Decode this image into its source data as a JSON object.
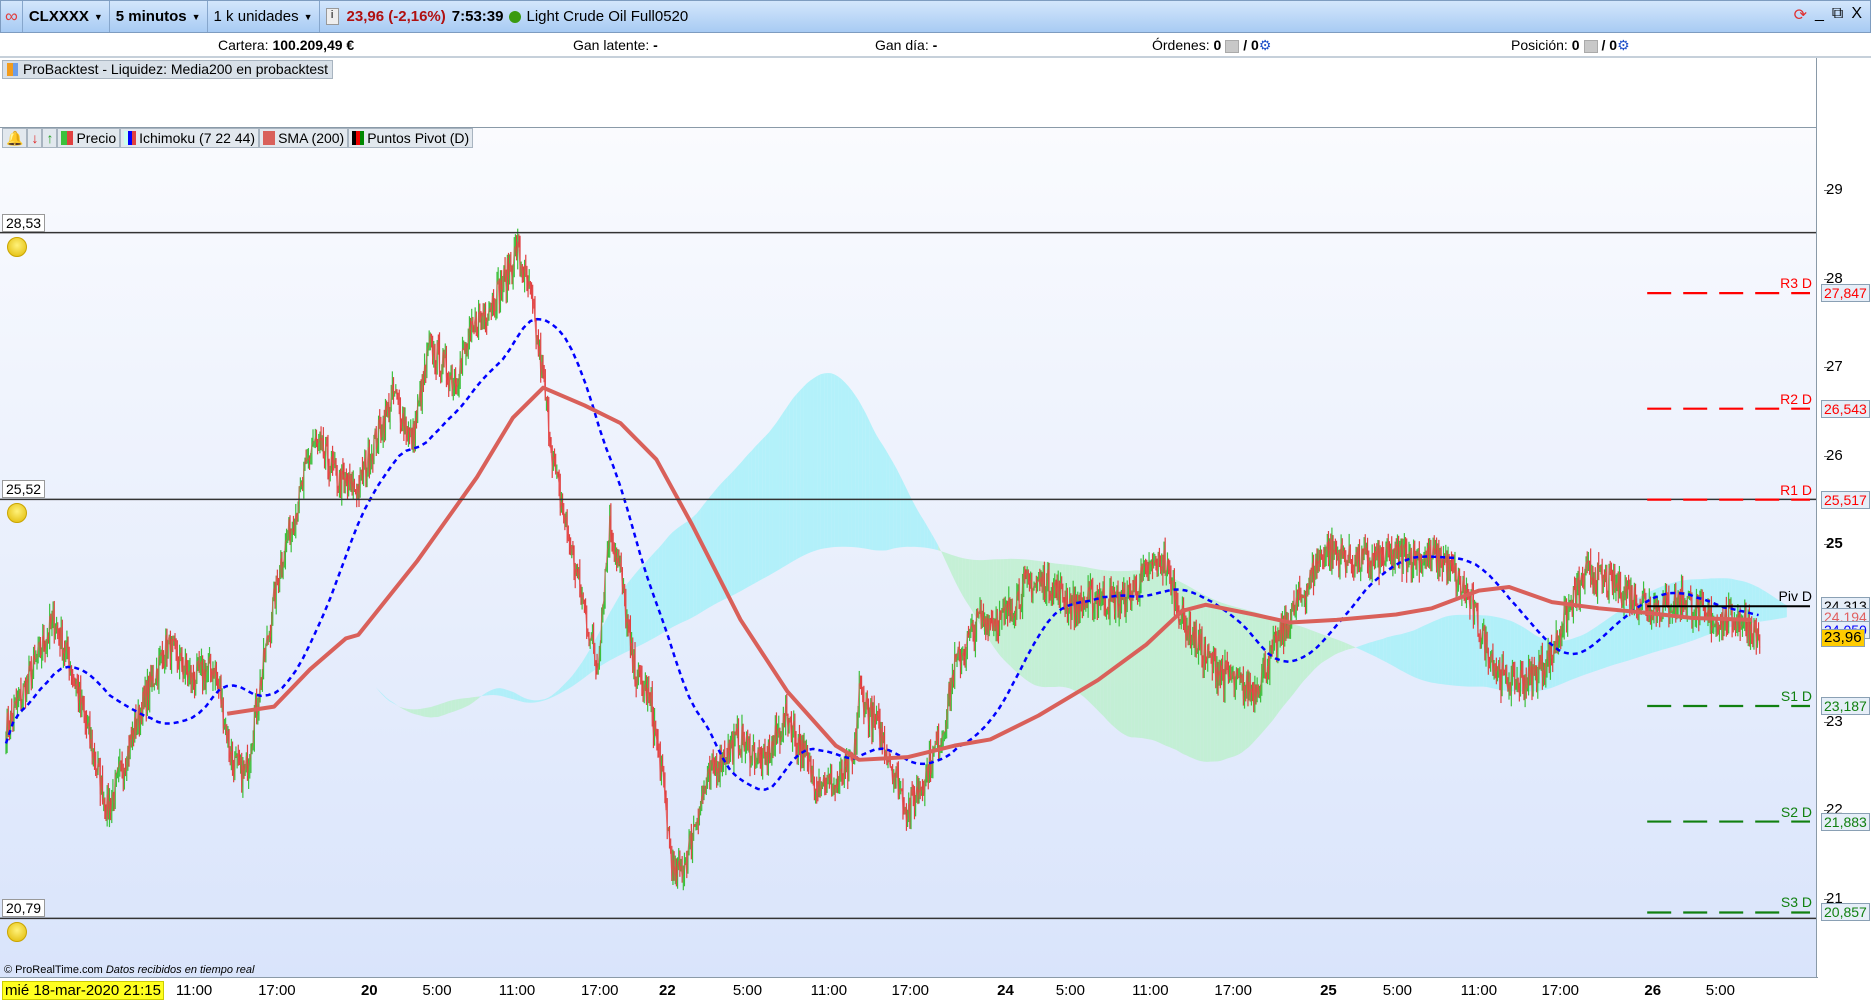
{
  "toolbar": {
    "symbol": "CLXXXX",
    "timeframe": "5 minutos",
    "units": "1 k unidades",
    "last_price": "23,96 (-2,16%)",
    "time": "7:53:39",
    "instrument": "Light Crude Oil Full0520"
  },
  "info": {
    "cartera_label": "Cartera:",
    "cartera_value": "100.209,49 €",
    "gan_latente_label": "Gan latente:",
    "gan_latente_value": "-",
    "gan_dia_label": "Gan día:",
    "gan_dia_value": "-",
    "ordenes_label": "Órdenes:",
    "ordenes_a": "0",
    "ordenes_b": "/ 0",
    "posicion_label": "Posición:",
    "posicion_a": "0",
    "posicion_b": "/ 0"
  },
  "backtest": {
    "title": "ProBacktest - Liquidez: Media200 en probacktest"
  },
  "legend": {
    "precio": "Precio",
    "ichimoku": "Ichimoku (7 22 44)",
    "sma": "SMA (200)",
    "pivot": "Puntos Pivot (D)"
  },
  "colors": {
    "up": "#3cc03c",
    "down": "#e04040",
    "ichimoku": "#0000ff",
    "sma": "#d9605a",
    "pivot_r": "#ff0000",
    "pivot_s": "#108010",
    "pivot": "#000000"
  },
  "hlines": [
    {
      "label": "28,53",
      "value": 28.53
    },
    {
      "label": "25,52",
      "value": 25.52
    },
    {
      "label": "20,79",
      "value": 20.79
    }
  ],
  "footer": {
    "copyright": "© ProRealTime.com",
    "realtime": "Datos recibidos en tiempo real"
  },
  "chart_data": {
    "type": "line",
    "x_unit": "trading hours since mié 18-mar-2020 21:15",
    "ylim": [
      20.3,
      29.7
    ],
    "yticks": [
      {
        "label": "29",
        "v": 29
      },
      {
        "label": "28",
        "v": 28
      },
      {
        "label": "27",
        "v": 27
      },
      {
        "label": "26",
        "v": 26
      },
      {
        "label": "25",
        "v": 25,
        "bold": true
      },
      {
        "label": "23",
        "v": 23
      },
      {
        "label": "22",
        "v": 22
      },
      {
        "label": "21",
        "v": 21
      }
    ],
    "xticks": [
      {
        "label": "11:00",
        "h": 13.7
      },
      {
        "label": "17:00",
        "h": 19.7
      },
      {
        "label": "20",
        "h": 26.4,
        "bold": true
      },
      {
        "label": "5:00",
        "h": 31.3
      },
      {
        "label": "11:00",
        "h": 37.1
      },
      {
        "label": "17:00",
        "h": 43.1
      },
      {
        "label": "22",
        "h": 48.0,
        "bold": true
      },
      {
        "label": "5:00",
        "h": 53.8
      },
      {
        "label": "11:00",
        "h": 59.7
      },
      {
        "label": "17:00",
        "h": 65.6
      },
      {
        "label": "24",
        "h": 72.5,
        "bold": true
      },
      {
        "label": "5:00",
        "h": 77.2
      },
      {
        "label": "11:00",
        "h": 83.0
      },
      {
        "label": "17:00",
        "h": 89.0
      },
      {
        "label": "25",
        "h": 95.9,
        "bold": true
      },
      {
        "label": "5:00",
        "h": 100.9
      },
      {
        "label": "11:00",
        "h": 106.8
      },
      {
        "label": "17:00",
        "h": 112.7
      },
      {
        "label": "26",
        "h": 119.4,
        "bold": true
      },
      {
        "label": "5:00",
        "h": 124.3
      }
    ],
    "start_label": "mié 18-mar-2020 21:15",
    "price": [
      [
        0.07,
        22.94
      ],
      [
        1.37,
        23.35
      ],
      [
        3.53,
        24.16
      ],
      [
        4.83,
        23.62
      ],
      [
        6.56,
        22.54
      ],
      [
        7.43,
        22.0
      ],
      [
        8.29,
        22.4
      ],
      [
        10.0,
        23.21
      ],
      [
        11.75,
        23.88
      ],
      [
        13.5,
        23.48
      ],
      [
        15.2,
        23.62
      ],
      [
        16.5,
        22.54
      ],
      [
        17.4,
        22.4
      ],
      [
        18.7,
        23.62
      ],
      [
        20.0,
        24.83
      ],
      [
        21.3,
        25.5
      ],
      [
        22.3,
        26.17
      ],
      [
        23.0,
        26.04
      ],
      [
        24.3,
        25.7
      ],
      [
        25.6,
        25.64
      ],
      [
        26.5,
        26.04
      ],
      [
        28.2,
        26.71
      ],
      [
        29.5,
        26.17
      ],
      [
        30.8,
        27.25
      ],
      [
        32.5,
        26.85
      ],
      [
        34.2,
        27.52
      ],
      [
        36.0,
        27.92
      ],
      [
        37.1,
        28.33
      ],
      [
        38.1,
        27.79
      ],
      [
        39.0,
        26.85
      ],
      [
        39.9,
        25.77
      ],
      [
        41.2,
        24.83
      ],
      [
        42.0,
        24.29
      ],
      [
        42.9,
        23.62
      ],
      [
        43.8,
        25.23
      ],
      [
        44.6,
        24.69
      ],
      [
        45.5,
        23.62
      ],
      [
        46.8,
        23.21
      ],
      [
        47.6,
        22.4
      ],
      [
        48.5,
        21.19
      ],
      [
        49.4,
        21.46
      ],
      [
        50.2,
        22.0
      ],
      [
        51.5,
        22.54
      ],
      [
        53.3,
        22.81
      ],
      [
        55.0,
        22.54
      ],
      [
        56.7,
        23.08
      ],
      [
        58.5,
        22.4
      ],
      [
        60.2,
        22.27
      ],
      [
        61.5,
        22.54
      ],
      [
        61.9,
        23.35
      ],
      [
        63.6,
        22.81
      ],
      [
        65.4,
        22.0
      ],
      [
        66.7,
        22.4
      ],
      [
        68.0,
        22.94
      ],
      [
        68.8,
        23.62
      ],
      [
        70.6,
        24.16
      ],
      [
        72.3,
        24.16
      ],
      [
        74.0,
        24.56
      ],
      [
        75.8,
        24.56
      ],
      [
        77.5,
        24.29
      ],
      [
        79.2,
        24.42
      ],
      [
        81.0,
        24.35
      ],
      [
        82.7,
        24.69
      ],
      [
        84.0,
        24.83
      ],
      [
        85.3,
        24.16
      ],
      [
        87.0,
        23.75
      ],
      [
        88.7,
        23.48
      ],
      [
        90.5,
        23.35
      ],
      [
        91.3,
        23.62
      ],
      [
        93.1,
        24.16
      ],
      [
        94.8,
        24.69
      ],
      [
        95.7,
        24.96
      ],
      [
        97.4,
        24.83
      ],
      [
        99.1,
        24.83
      ],
      [
        101.7,
        24.9
      ],
      [
        104.3,
        24.83
      ],
      [
        106.0,
        24.42
      ],
      [
        107.3,
        23.88
      ],
      [
        108.6,
        23.48
      ],
      [
        110.4,
        23.48
      ],
      [
        112.1,
        23.75
      ],
      [
        112.9,
        24.16
      ],
      [
        114.7,
        24.69
      ],
      [
        116.4,
        24.56
      ],
      [
        118.1,
        24.42
      ],
      [
        119.9,
        24.29
      ],
      [
        121.6,
        24.42
      ],
      [
        123.3,
        24.16
      ],
      [
        125.9,
        24.16
      ],
      [
        127.2,
        23.96
      ]
    ],
    "sma": [
      [
        16.1,
        23.1
      ],
      [
        19.5,
        23.18
      ],
      [
        22.1,
        23.6
      ],
      [
        24.7,
        23.95
      ],
      [
        25.6,
        23.99
      ],
      [
        29.9,
        24.83
      ],
      [
        34.2,
        25.77
      ],
      [
        36.8,
        26.44
      ],
      [
        39.0,
        26.78
      ],
      [
        42.0,
        26.58
      ],
      [
        44.6,
        26.38
      ],
      [
        47.2,
        25.97
      ],
      [
        49.8,
        25.23
      ],
      [
        53.3,
        24.16
      ],
      [
        56.7,
        23.35
      ],
      [
        60.2,
        22.74
      ],
      [
        61.9,
        22.58
      ],
      [
        65.4,
        22.61
      ],
      [
        68.8,
        22.74
      ],
      [
        71.4,
        22.81
      ],
      [
        74.9,
        23.08
      ],
      [
        79.2,
        23.48
      ],
      [
        82.7,
        23.88
      ],
      [
        85.3,
        24.26
      ],
      [
        87.0,
        24.33
      ],
      [
        90.5,
        24.22
      ],
      [
        93.1,
        24.13
      ],
      [
        96.5,
        24.16
      ],
      [
        100.8,
        24.22
      ],
      [
        103.4,
        24.29
      ],
      [
        106.8,
        24.49
      ],
      [
        109.0,
        24.53
      ],
      [
        112.1,
        24.36
      ],
      [
        115.5,
        24.29
      ],
      [
        118.9,
        24.24
      ],
      [
        122.3,
        24.18
      ],
      [
        126.6,
        24.16
      ]
    ],
    "pivots": [
      {
        "name": "R3 D",
        "value": 27.847,
        "label": "27,847",
        "kind": "r"
      },
      {
        "name": "R2 D",
        "value": 26.543,
        "label": "26,543",
        "kind": "r"
      },
      {
        "name": "R1 D",
        "value": 25.517,
        "label": "25,517",
        "kind": "r"
      },
      {
        "name": "Piv D",
        "value": 24.313,
        "label": "24,313",
        "kind": "p"
      },
      {
        "name": "S1 D",
        "value": 23.187,
        "label": "23,187",
        "kind": "s"
      },
      {
        "name": "S2 D",
        "value": 21.883,
        "label": "21,883",
        "kind": "s"
      },
      {
        "name": "S3 D",
        "value": 20.857,
        "label": "20,857",
        "kind": "s"
      }
    ],
    "pivot_start_h": 119.0,
    "axis_markers": [
      {
        "label": "24,194",
        "value": 24.194,
        "color": "#e06060"
      },
      {
        "label": "24,050",
        "value": 24.05,
        "color": "#0000ff"
      },
      {
        "label": "23,96",
        "value": 23.96,
        "color": "#000",
        "bg": "#ffcc00"
      }
    ]
  }
}
